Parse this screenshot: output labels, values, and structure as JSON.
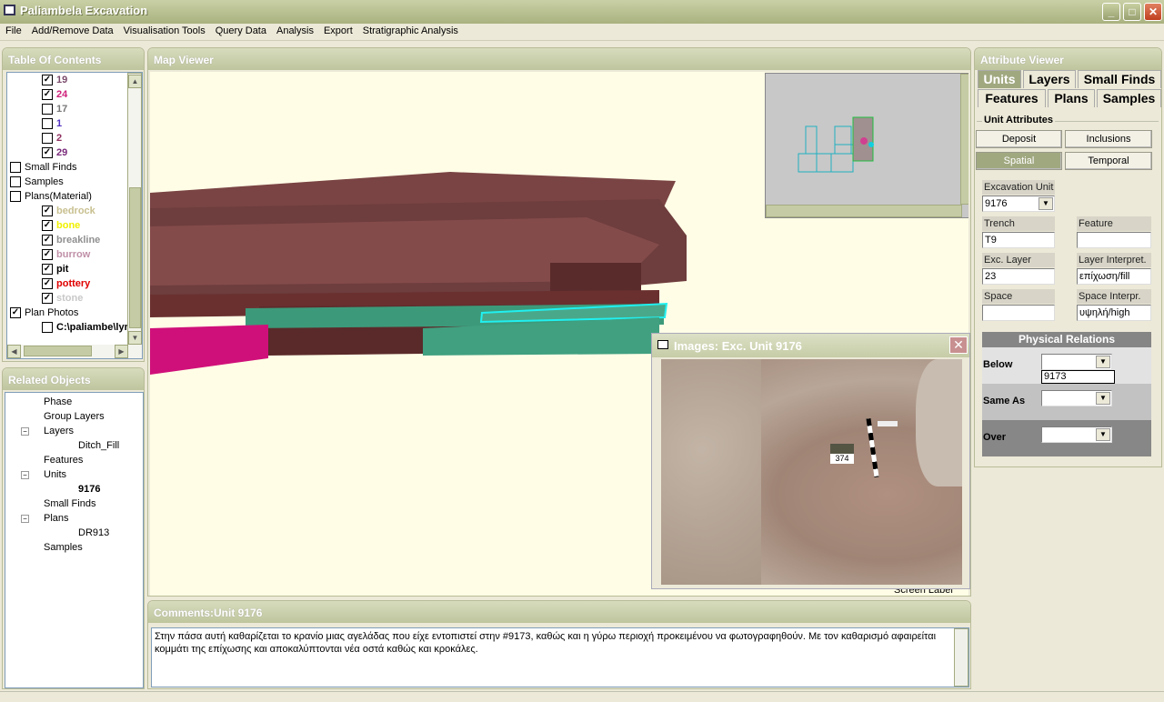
{
  "window": {
    "title": "Paliambela Excavation",
    "minimize": "_",
    "maximize": "□",
    "close": "✕"
  },
  "menu": [
    "File",
    "Add/Remove Data",
    "Visualisation Tools",
    "Query Data",
    "Analysis",
    "Export",
    "Stratigraphic Analysis"
  ],
  "toc": {
    "title": "Table Of Contents",
    "items": [
      {
        "label": "19",
        "checked": true,
        "color": "#7a4a6a",
        "level": 2
      },
      {
        "label": "24",
        "checked": true,
        "color": "#d0207a",
        "level": 2
      },
      {
        "label": "17",
        "checked": false,
        "color": "#777777",
        "level": 2
      },
      {
        "label": "1",
        "checked": false,
        "color": "#5030c0",
        "level": 2
      },
      {
        "label": "2",
        "checked": false,
        "color": "#903060",
        "level": 2
      },
      {
        "label": "29",
        "checked": true,
        "color": "#7a2a7a",
        "level": 2
      },
      {
        "label": "Small Finds",
        "checked": false,
        "color": "#000000",
        "level": 0
      },
      {
        "label": "Samples",
        "checked": false,
        "color": "#000000",
        "level": 0
      },
      {
        "label": "Plans(Material)",
        "checked": false,
        "color": "#000000",
        "level": 0
      },
      {
        "label": "bedrock",
        "checked": true,
        "color": "#c8c090",
        "level": 2
      },
      {
        "label": "bone",
        "checked": true,
        "color": "#f0f000",
        "level": 2
      },
      {
        "label": "breakline",
        "checked": true,
        "color": "#909090",
        "level": 2
      },
      {
        "label": "burrow",
        "checked": true,
        "color": "#c090a8",
        "level": 2
      },
      {
        "label": "pit",
        "checked": true,
        "color": "#000000",
        "level": 2
      },
      {
        "label": "pottery",
        "checked": true,
        "color": "#e00000",
        "level": 2
      },
      {
        "label": "stone",
        "checked": true,
        "color": "#c8c8c8",
        "level": 2
      },
      {
        "label": "Plan Photos",
        "checked": true,
        "color": "#000000",
        "level": 0
      },
      {
        "label": "C:\\paliambe\\lyrs",
        "checked": false,
        "color": "#000000",
        "level": 2
      }
    ]
  },
  "related": {
    "title": "Related Objects",
    "items": [
      {
        "label": "Phase",
        "level": 1,
        "bold": false
      },
      {
        "label": "Group Layers",
        "level": 1,
        "bold": false
      },
      {
        "label": "Layers",
        "level": 1,
        "bold": false,
        "expander": "−"
      },
      {
        "label": "Ditch_Fill",
        "level": 2,
        "bold": false
      },
      {
        "label": "Features",
        "level": 1,
        "bold": false
      },
      {
        "label": "Units",
        "level": 1,
        "bold": false,
        "expander": "−"
      },
      {
        "label": "9176",
        "level": 2,
        "bold": true
      },
      {
        "label": "Small Finds",
        "level": 1,
        "bold": false
      },
      {
        "label": "Plans",
        "level": 1,
        "bold": false,
        "expander": "−"
      },
      {
        "label": "DR913",
        "level": 2,
        "bold": false
      },
      {
        "label": "Samples",
        "level": 1,
        "bold": false
      }
    ]
  },
  "map": {
    "title": "Map Viewer",
    "background": "#fffde6",
    "hidden_label": "Screen Label"
  },
  "images": {
    "title": "Images: Exc. Unit 9176",
    "photo_label": "374"
  },
  "comments": {
    "title": "Comments:Unit 9176",
    "text": "Στην πάσα αυτή καθαρίζεται το κρανίο μιας αγελάδας που είχε εντοπιστεί στην #9173, καθώς και η γύρω περιοχή προκειμένου να φωτογραφηθούν. Με τον καθαρισμό αφαιρείται κομμάτι της επίχωσης και αποκαλύπτονται νέα οστά καθώς και κροκάλες."
  },
  "attr": {
    "title": "Attribute Viewer",
    "tabs": [
      "Units",
      "Layers",
      "Small Finds",
      "Features",
      "Plans",
      "Samples"
    ],
    "active_tab": "Units",
    "group": "Unit Attributes",
    "subtabs": [
      "Deposit",
      "Inclusions",
      "Spatial",
      "Temporal"
    ],
    "active_subtab": "Spatial",
    "fields": {
      "exc_unit_label": "Excavation Unit",
      "exc_unit": "9176",
      "trench_label": "Trench",
      "trench": "T9",
      "feature_label": "Feature",
      "feature": "",
      "exc_layer_label": "Exc. Layer",
      "exc_layer": "23",
      "layer_interp_label": "Layer Interpret.",
      "layer_interp": "επίχωση/fill",
      "space_label": "Space",
      "space": "",
      "space_interp_label": "Space Interpr.",
      "space_interp": "υψηλή/high"
    },
    "relations": {
      "title": "Physical Relations",
      "below_label": "Below",
      "below_value": "",
      "below_option": "9173",
      "same_as_label": "Same As",
      "over_label": "Over"
    }
  }
}
